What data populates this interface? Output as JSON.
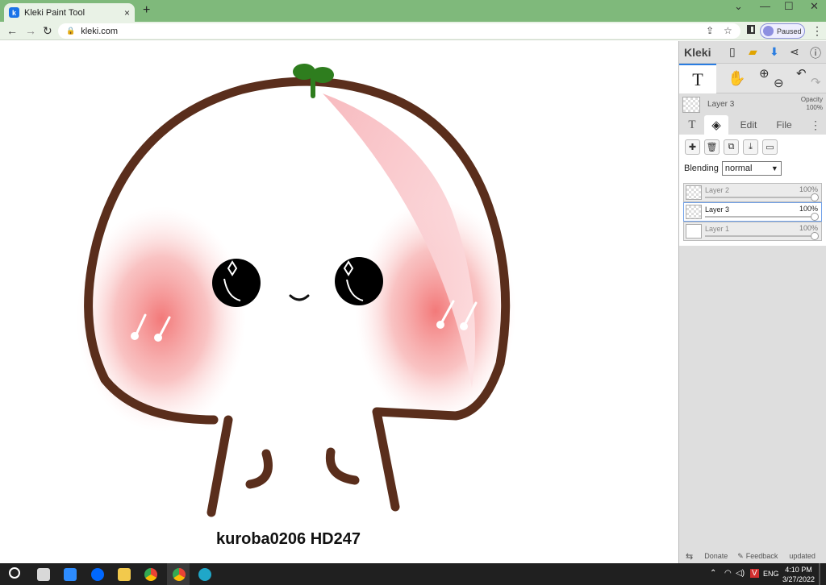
{
  "browser": {
    "tab_title": "Kleki Paint Tool",
    "tab_close": "×",
    "new_tab": "+",
    "url": "kleki.com",
    "profile_status": "Paused",
    "back": "←",
    "forward": "→",
    "reload": "↻",
    "menu": "⋮",
    "min": "⌄",
    "minimize": "—",
    "maximize": "☐",
    "close": "✕"
  },
  "canvas": {
    "signature": "kuroba0206 HD247"
  },
  "panel": {
    "logo": "Kleki",
    "tool_text": "T",
    "active_layer": "Layer 3",
    "opacity_label": "Opacity",
    "opacity_value": "100%",
    "tabs": {
      "text": "T",
      "edit": "Edit",
      "file": "File",
      "more": "⋮"
    },
    "blending_label": "Blending",
    "blending_value": "normal",
    "layers": [
      {
        "name": "Layer 2",
        "opacity": "100%",
        "selected": false
      },
      {
        "name": "Layer 3",
        "opacity": "100%",
        "selected": true
      },
      {
        "name": "Layer 1",
        "opacity": "100%",
        "selected": false
      }
    ],
    "footer": {
      "donate": "Donate",
      "feedback": "Feedback",
      "updated": "updated"
    }
  },
  "taskbar": {
    "language": "ENG",
    "time": "4:10 PM",
    "date": "3/27/2022"
  },
  "colors": {
    "chrome_green": "#7fb97b",
    "accent_blue": "#2a7de1",
    "outline_brown": "#5a2e1c",
    "blush": "#f07a7a",
    "sprout": "#2e7d1e"
  }
}
